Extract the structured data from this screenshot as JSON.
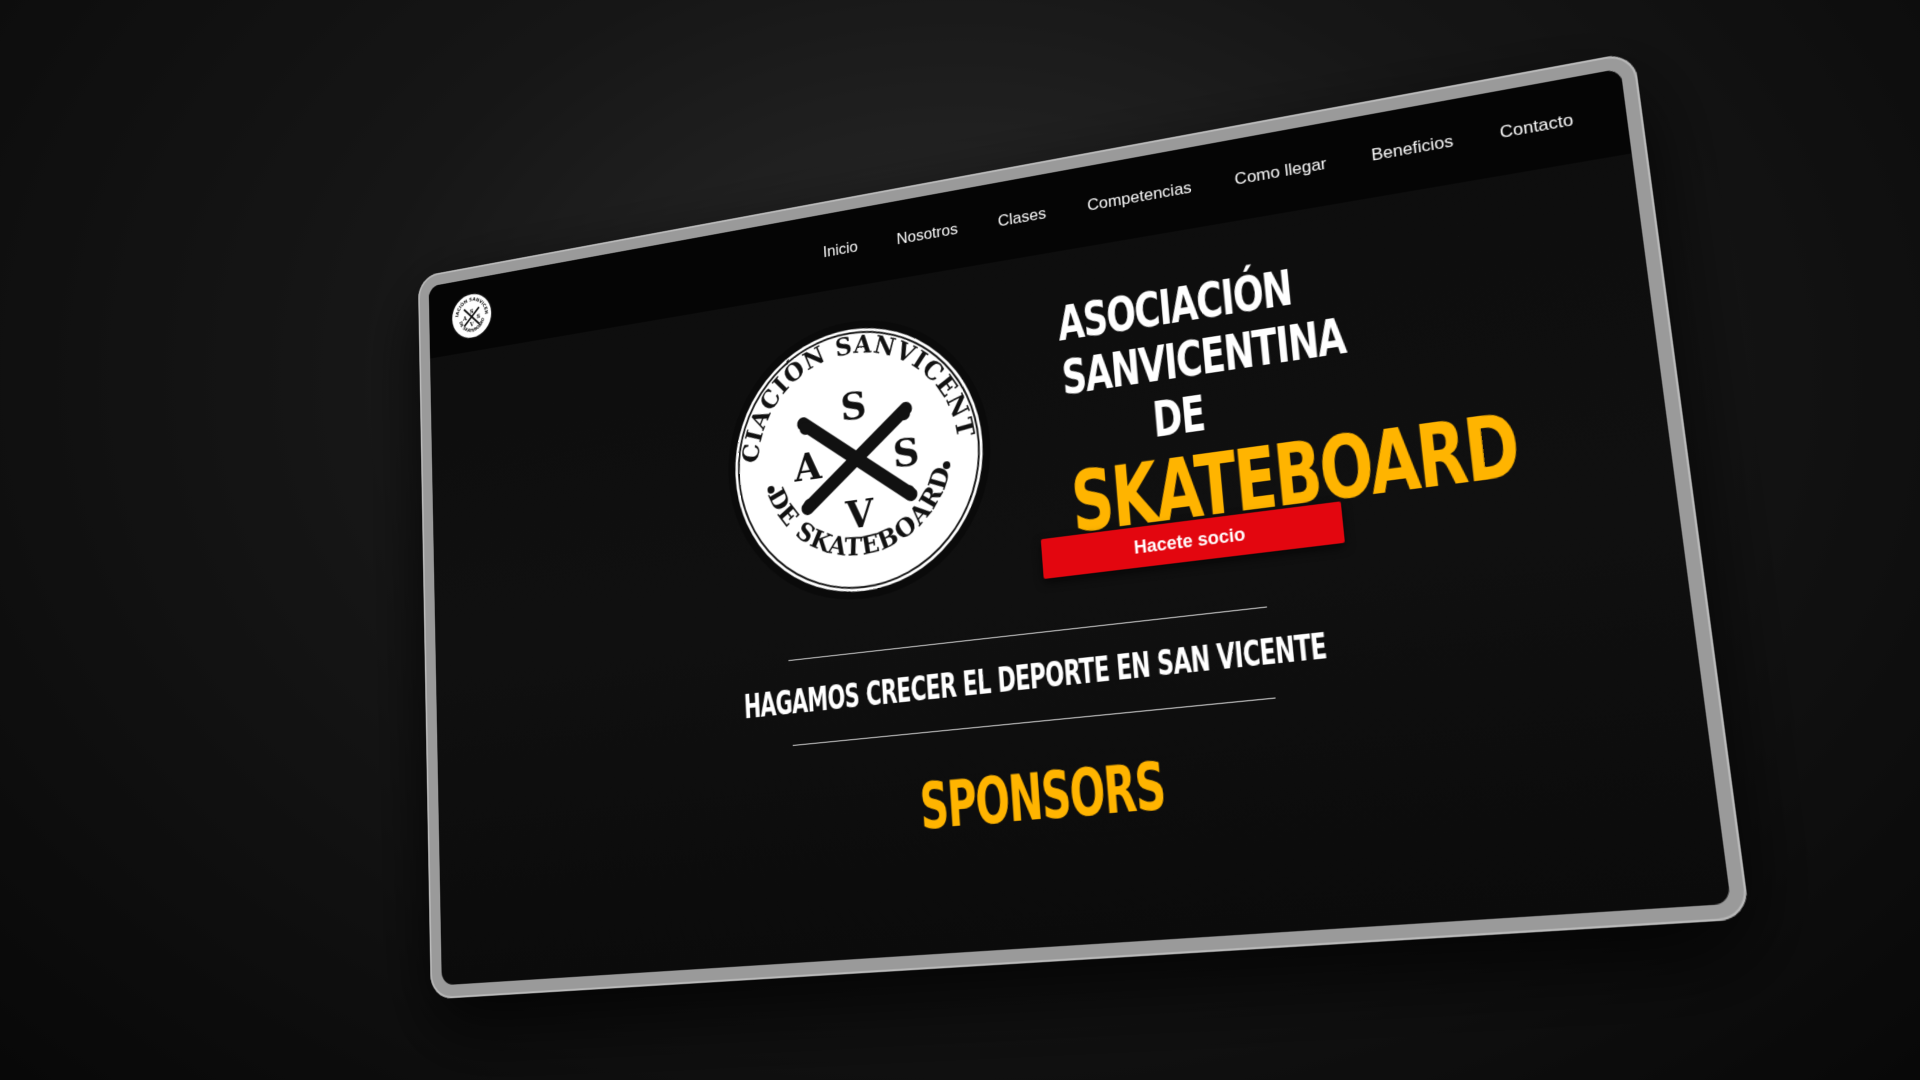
{
  "nav": {
    "logo_text_top": "ASOCIACIÓN SANVICENTINA",
    "logo_text_bottom": "DE SKATEBOARD",
    "items": [
      {
        "label": "Inicio"
      },
      {
        "label": "Nosotros"
      },
      {
        "label": "Clases"
      },
      {
        "label": "Competencias"
      },
      {
        "label": "Como llegar"
      },
      {
        "label": "Beneficios"
      },
      {
        "label": "Contacto"
      }
    ]
  },
  "hero": {
    "logo": {
      "ring_top": "ASOCIACIÓN SANVICENTINA",
      "ring_bottom": "DE SKATEBOARD",
      "letter_top": "S",
      "letter_left": "A",
      "letter_right": "S",
      "letter_bottom": "V"
    },
    "title_line1": "ASOCIACIÓN",
    "title_line2": "SANVICENTINA DE",
    "title_accent": "SKATEBOARD",
    "cta_label": "Hacete socio"
  },
  "tagline": "HAGAMOS CRECER EL DEPORTE EN SAN VICENTE",
  "sponsors": {
    "heading": "SPONSORS"
  },
  "colors": {
    "accent_yellow": "#ffb400",
    "cta_red": "#e3060f",
    "background": "#0d0d0d"
  }
}
